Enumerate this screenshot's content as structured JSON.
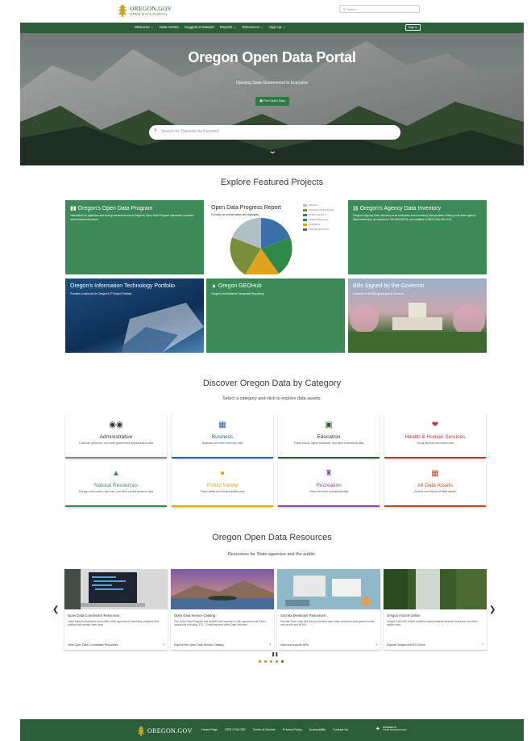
{
  "header": {
    "logo_main": "OREGON.GOV",
    "logo_sub": "OPEN DATA PORTAL",
    "search_placeholder": "Search"
  },
  "nav": {
    "items": [
      "Welcome ⌄",
      "Data Assets",
      "Suggest a Dataset",
      "Reports ⌄",
      "Resources ⌄",
      "Sign up ⌄"
    ],
    "signin": "Sign in"
  },
  "hero": {
    "title": "Oregon Open Data Portal",
    "subtitle": "Opening State Government to Everyone",
    "button": "Find Open Data",
    "search_placeholder": "Search for Datasets by Keyword"
  },
  "featured": {
    "heading": "Explore Featured Projects",
    "cards": [
      {
        "title": "Oregon's Open Data Program",
        "desc": "Information for agencies and local governments about Oregon's Open Data Program standards, business and technical resources."
      },
      {
        "title": "Open Data Progress Report",
        "desc": "Provides an overall status and highlights.",
        "legend": [
          "HEALTH",
          "NATURAL RESOURCES",
          "PUBLIC SAFETY",
          "ADMINISTRATION",
          "BUSINESS",
          "TRANSPORTATION"
        ]
      },
      {
        "title": "Oregon's Agency Data Inventory",
        "desc": "Oregon's Agency Data Inventory is an enterprise-level inventory that provides a listing of all state agency data inventories, as required in HB 3361(2017), and codified in ORS 276A.353-.374."
      },
      {
        "title": "Oregon's Information Technology Portfolio",
        "desc": "Provides a resource for Oregon's IT Project Portfolio."
      },
      {
        "title": "Oregon GEOHub",
        "desc": "Oregon's Authoritative Geospatial Repository."
      },
      {
        "title": "Bills Signed by the Governor",
        "desc": "A dataset of all bills signed by the Governor."
      }
    ]
  },
  "categories": {
    "heading": "Discover Oregon Data by Category",
    "subheading": "Select a category and click to explore data assets.",
    "items": [
      {
        "name": "Administrative",
        "desc": "Financial, workforce, and other government administrative data",
        "color": "#333333"
      },
      {
        "name": "Business",
        "desc": "Business and other economic data",
        "color": "#2c5fa8"
      },
      {
        "name": "Education",
        "desc": "Public school, higher education, and other educational data",
        "color": "#2d5e3a"
      },
      {
        "name": "Health & Human Services",
        "desc": "Social services and health data",
        "color": "#c6343b"
      },
      {
        "name": "Natural Resources",
        "desc": "Energy, environment, land use, and other natural resource data",
        "color": "#3b8a57"
      },
      {
        "name": "Public Safety",
        "desc": "Public safety and criminal justice data",
        "color": "#e6a817"
      },
      {
        "name": "Recreation",
        "desc": "Parks and other recreational data",
        "color": "#8b4ba8"
      },
      {
        "name": "All Data Assets",
        "desc": "Browse and explore all data assets",
        "color": "#b3512b"
      }
    ]
  },
  "resources": {
    "heading": "Oregon Open Data Resources",
    "subheading": "Resources for State agencies and the public.",
    "items": [
      {
        "title": "Open Data Coordinator Resources",
        "desc": "Open Data Coordinators work within their agencies to inventory, prioritize and publish high quality open data.",
        "link": "View Open Data Coordinator Resources"
      },
      {
        "title": "Open Data Service Catalog",
        "desc": "The Open Data Program has drafted data experts to help agencies reach their data goals including, ETL, Consulting and other Data Services.",
        "link": "Explore the Open Data Service Catalog"
      },
      {
        "title": "Socrata Developer Resources",
        "desc": "Socrata Open Data API lets you access open data resources from governments, non-profits and NGOs.",
        "link": "View and explore APIs"
      },
      {
        "title": "Oregon ArcGIS Online",
        "desc": "Oregon's ArcGIS Online contains maps featured services that show and other spatial data.",
        "link": "Explore Oregon ArcGIS Online"
      }
    ]
  },
  "footer": {
    "logo": "OREGON.GOV",
    "links": [
      "Home Page",
      "ORS 276A.350",
      "Terms of Service",
      "Privacy Policy",
      "Accessibility",
      "Contact Us"
    ],
    "powered_1": "POWERED BY",
    "powered_2": "TYLER TECHNOLOGIES"
  }
}
